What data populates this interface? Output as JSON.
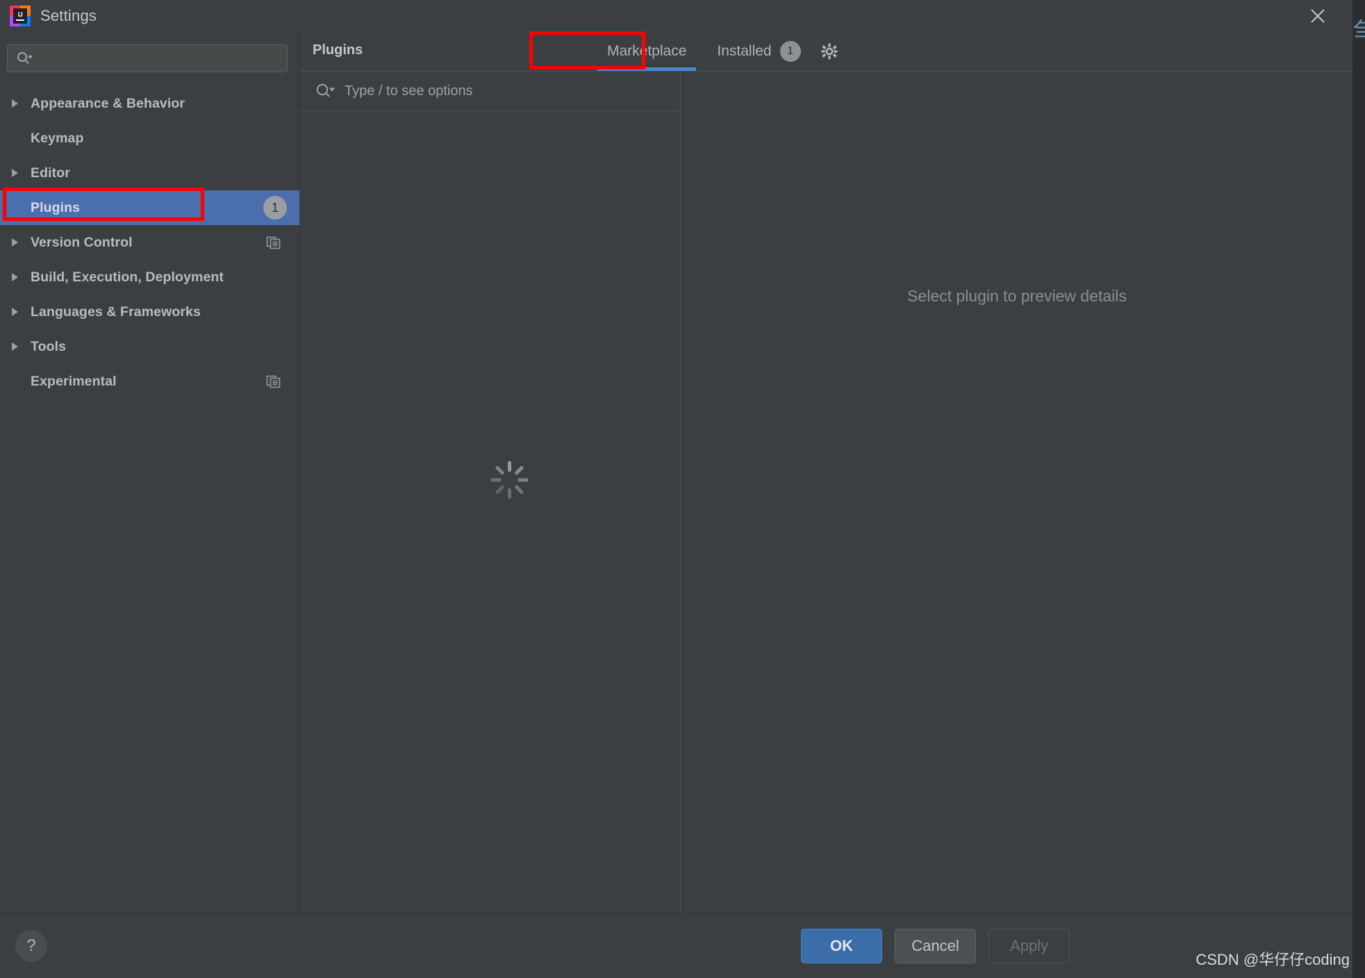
{
  "window": {
    "title": "Settings",
    "logo_text": "IJ",
    "close_icon": "close-icon"
  },
  "sidebar": {
    "search": {
      "value": "",
      "placeholder": "",
      "icon": "search-icon"
    },
    "items": [
      {
        "label": "Appearance & Behavior",
        "expandable": true,
        "selected": false,
        "badge": null,
        "row_icon": null
      },
      {
        "label": "Keymap",
        "expandable": false,
        "selected": false,
        "badge": null,
        "row_icon": null
      },
      {
        "label": "Editor",
        "expandable": true,
        "selected": false,
        "badge": null,
        "row_icon": null
      },
      {
        "label": "Plugins",
        "expandable": false,
        "selected": true,
        "badge": "1",
        "row_icon": null
      },
      {
        "label": "Version Control",
        "expandable": true,
        "selected": false,
        "badge": null,
        "row_icon": "copy-settings-icon"
      },
      {
        "label": "Build, Execution, Deployment",
        "expandable": true,
        "selected": false,
        "badge": null,
        "row_icon": null
      },
      {
        "label": "Languages & Frameworks",
        "expandable": true,
        "selected": false,
        "badge": null,
        "row_icon": null
      },
      {
        "label": "Tools",
        "expandable": true,
        "selected": false,
        "badge": null,
        "row_icon": null
      },
      {
        "label": "Experimental",
        "expandable": false,
        "selected": false,
        "badge": null,
        "row_icon": "copy-settings-icon"
      }
    ]
  },
  "content": {
    "panel_title": "Plugins",
    "tabs": [
      {
        "label": "Marketplace",
        "active": true,
        "badge": null
      },
      {
        "label": "Installed",
        "active": false,
        "badge": "1"
      }
    ],
    "gear_icon": "gear-icon",
    "plugin_search": {
      "value": "",
      "placeholder": "Type / to see options",
      "icon": "search-icon"
    },
    "loading_icon": "loading-spinner-icon",
    "detail_placeholder": "Select plugin to preview details"
  },
  "footer": {
    "help_label": "?",
    "ok_label": "OK",
    "cancel_label": "Cancel",
    "apply_label": "Apply"
  },
  "watermark": "CSDN @华仔仔coding",
  "colors": {
    "dialog_bg": "#3c3f41",
    "selection_blue": "#4b6eaf",
    "accent_blue": "#4a88c7",
    "primary_button": "#3b6ea8",
    "annotation_red": "#ff0000",
    "text": "#bbbbbb",
    "muted_text": "#8a8e92"
  }
}
